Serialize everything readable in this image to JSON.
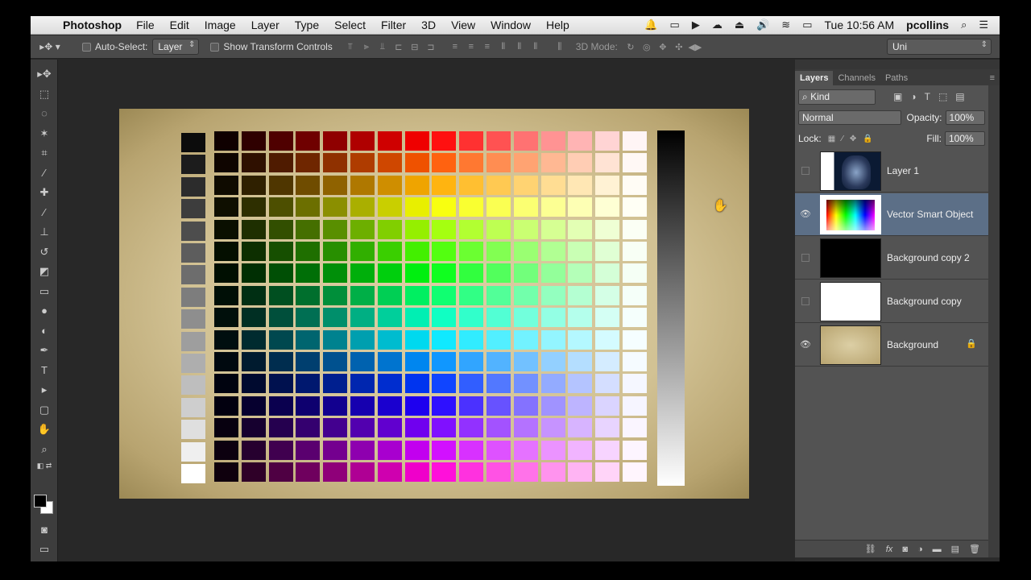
{
  "menubar": {
    "apple_icon": "apple-logo-icon",
    "app_name": "Photoshop",
    "menus": [
      "File",
      "Edit",
      "Image",
      "Layer",
      "Type",
      "Select",
      "Filter",
      "3D",
      "View",
      "Window",
      "Help"
    ],
    "clock": "Tue 10:56 AM",
    "user": "pcollins"
  },
  "options": {
    "auto_select_label": "Auto-Select:",
    "auto_select_value": "Layer",
    "show_transform_label": "Show Transform Controls",
    "mode3d_label": "3D Mode:",
    "workspace_value": "Uni"
  },
  "tools": [
    "move-tool-icon",
    "marquee-tool-icon",
    "lasso-tool-icon",
    "quick-select-tool-icon",
    "crop-tool-icon",
    "eyedropper-tool-icon",
    "healing-brush-tool-icon",
    "brush-tool-icon",
    "clone-stamp-tool-icon",
    "history-brush-tool-icon",
    "eraser-tool-icon",
    "gradient-tool-icon",
    "blur-tool-icon",
    "dodge-tool-icon",
    "pen-tool-icon",
    "type-tool-icon",
    "path-select-tool-icon",
    "shape-tool-icon",
    "hand-tool-icon",
    "zoom-tool-icon"
  ],
  "colors": {
    "foreground": "#000000",
    "background": "#ffffff",
    "selected_layer": "#5c6f87"
  },
  "layers_panel": {
    "tabs": [
      "Layers",
      "Channels",
      "Paths"
    ],
    "filter_value": "Kind",
    "blend_mode": "Normal",
    "opacity_label": "Opacity:",
    "opacity_value": "100%",
    "lock_label": "Lock:",
    "fill_label": "Fill:",
    "fill_value": "100%",
    "layers": [
      {
        "name": "Layer 1",
        "visible": false,
        "selected": false
      },
      {
        "name": "Vector Smart Object",
        "visible": true,
        "selected": true
      },
      {
        "name": "Background copy 2",
        "visible": false,
        "selected": false
      },
      {
        "name": "Background copy",
        "visible": false,
        "selected": false
      },
      {
        "name": "Background",
        "visible": true,
        "selected": false,
        "locked": true
      }
    ]
  }
}
